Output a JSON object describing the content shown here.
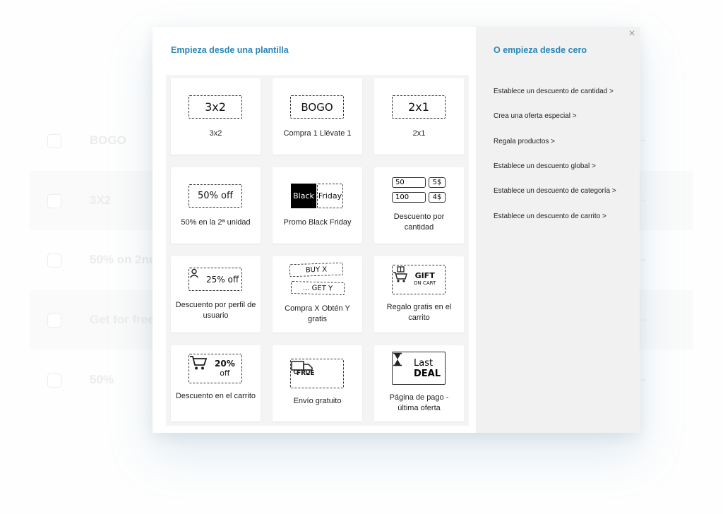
{
  "background": {
    "rows": [
      {
        "label": "BOGO"
      },
      {
        "label": "3X2"
      },
      {
        "label": "50% on 2nd"
      },
      {
        "label": "Get for free"
      },
      {
        "label": "50%"
      }
    ],
    "arrow_glyph": "→"
  },
  "modal": {
    "left_title": "Empieza desde una plantilla",
    "right_title": "O empieza desde cero",
    "close_glyph": "×",
    "templates": [
      {
        "label": "3x2",
        "badge": "3x2"
      },
      {
        "label": "Compra 1 Llévate 1",
        "badge": "BOGO"
      },
      {
        "label": "2x1",
        "badge": "2x1"
      },
      {
        "label": "50% en la 2ª unidad",
        "badge": "50% off"
      },
      {
        "label": "Promo Black Friday",
        "badge_left": "Black",
        "badge_right": "Friday"
      },
      {
        "label": "Descuento por cantidad",
        "rows": [
          {
            "qty": "50",
            "price": "5$"
          },
          {
            "qty": "100",
            "price": "4$"
          }
        ]
      },
      {
        "label": "Descuento por perfil de usuario",
        "badge": "25% off"
      },
      {
        "label": "Compra X Obtén Y gratis",
        "badge_top": "BUY X",
        "badge_bottom": "... GET Y"
      },
      {
        "label": "Regalo gratis en el carrito",
        "badge_top": "GIFT",
        "badge_bottom": "ON CART"
      },
      {
        "label": "Descuento en el carrito",
        "badge_top": "20%",
        "badge_bottom": "off"
      },
      {
        "label": "Envío gratuito",
        "badge": "FREE"
      },
      {
        "label": "Página de pago - última oferta",
        "badge_top": "Last",
        "badge_bottom": "DEAL"
      }
    ],
    "scratch_options": [
      "Establece un descuento de cantidad >",
      "Crea una oferta especial >",
      "Regala productos >",
      "Establece un descuento global >",
      "Establece un descuento de categoría >",
      "Establece un descuento de carrito >"
    ]
  },
  "colors": {
    "accent": "#2a86b7",
    "right_panel": "#f1f1f1"
  },
  "icons": {
    "close": "close-icon",
    "user": "user-icon",
    "gift_cart": "gift-cart-icon",
    "cart": "shopping-cart-icon",
    "truck": "delivery-truck-icon",
    "hourglass": "hourglass-icon"
  }
}
